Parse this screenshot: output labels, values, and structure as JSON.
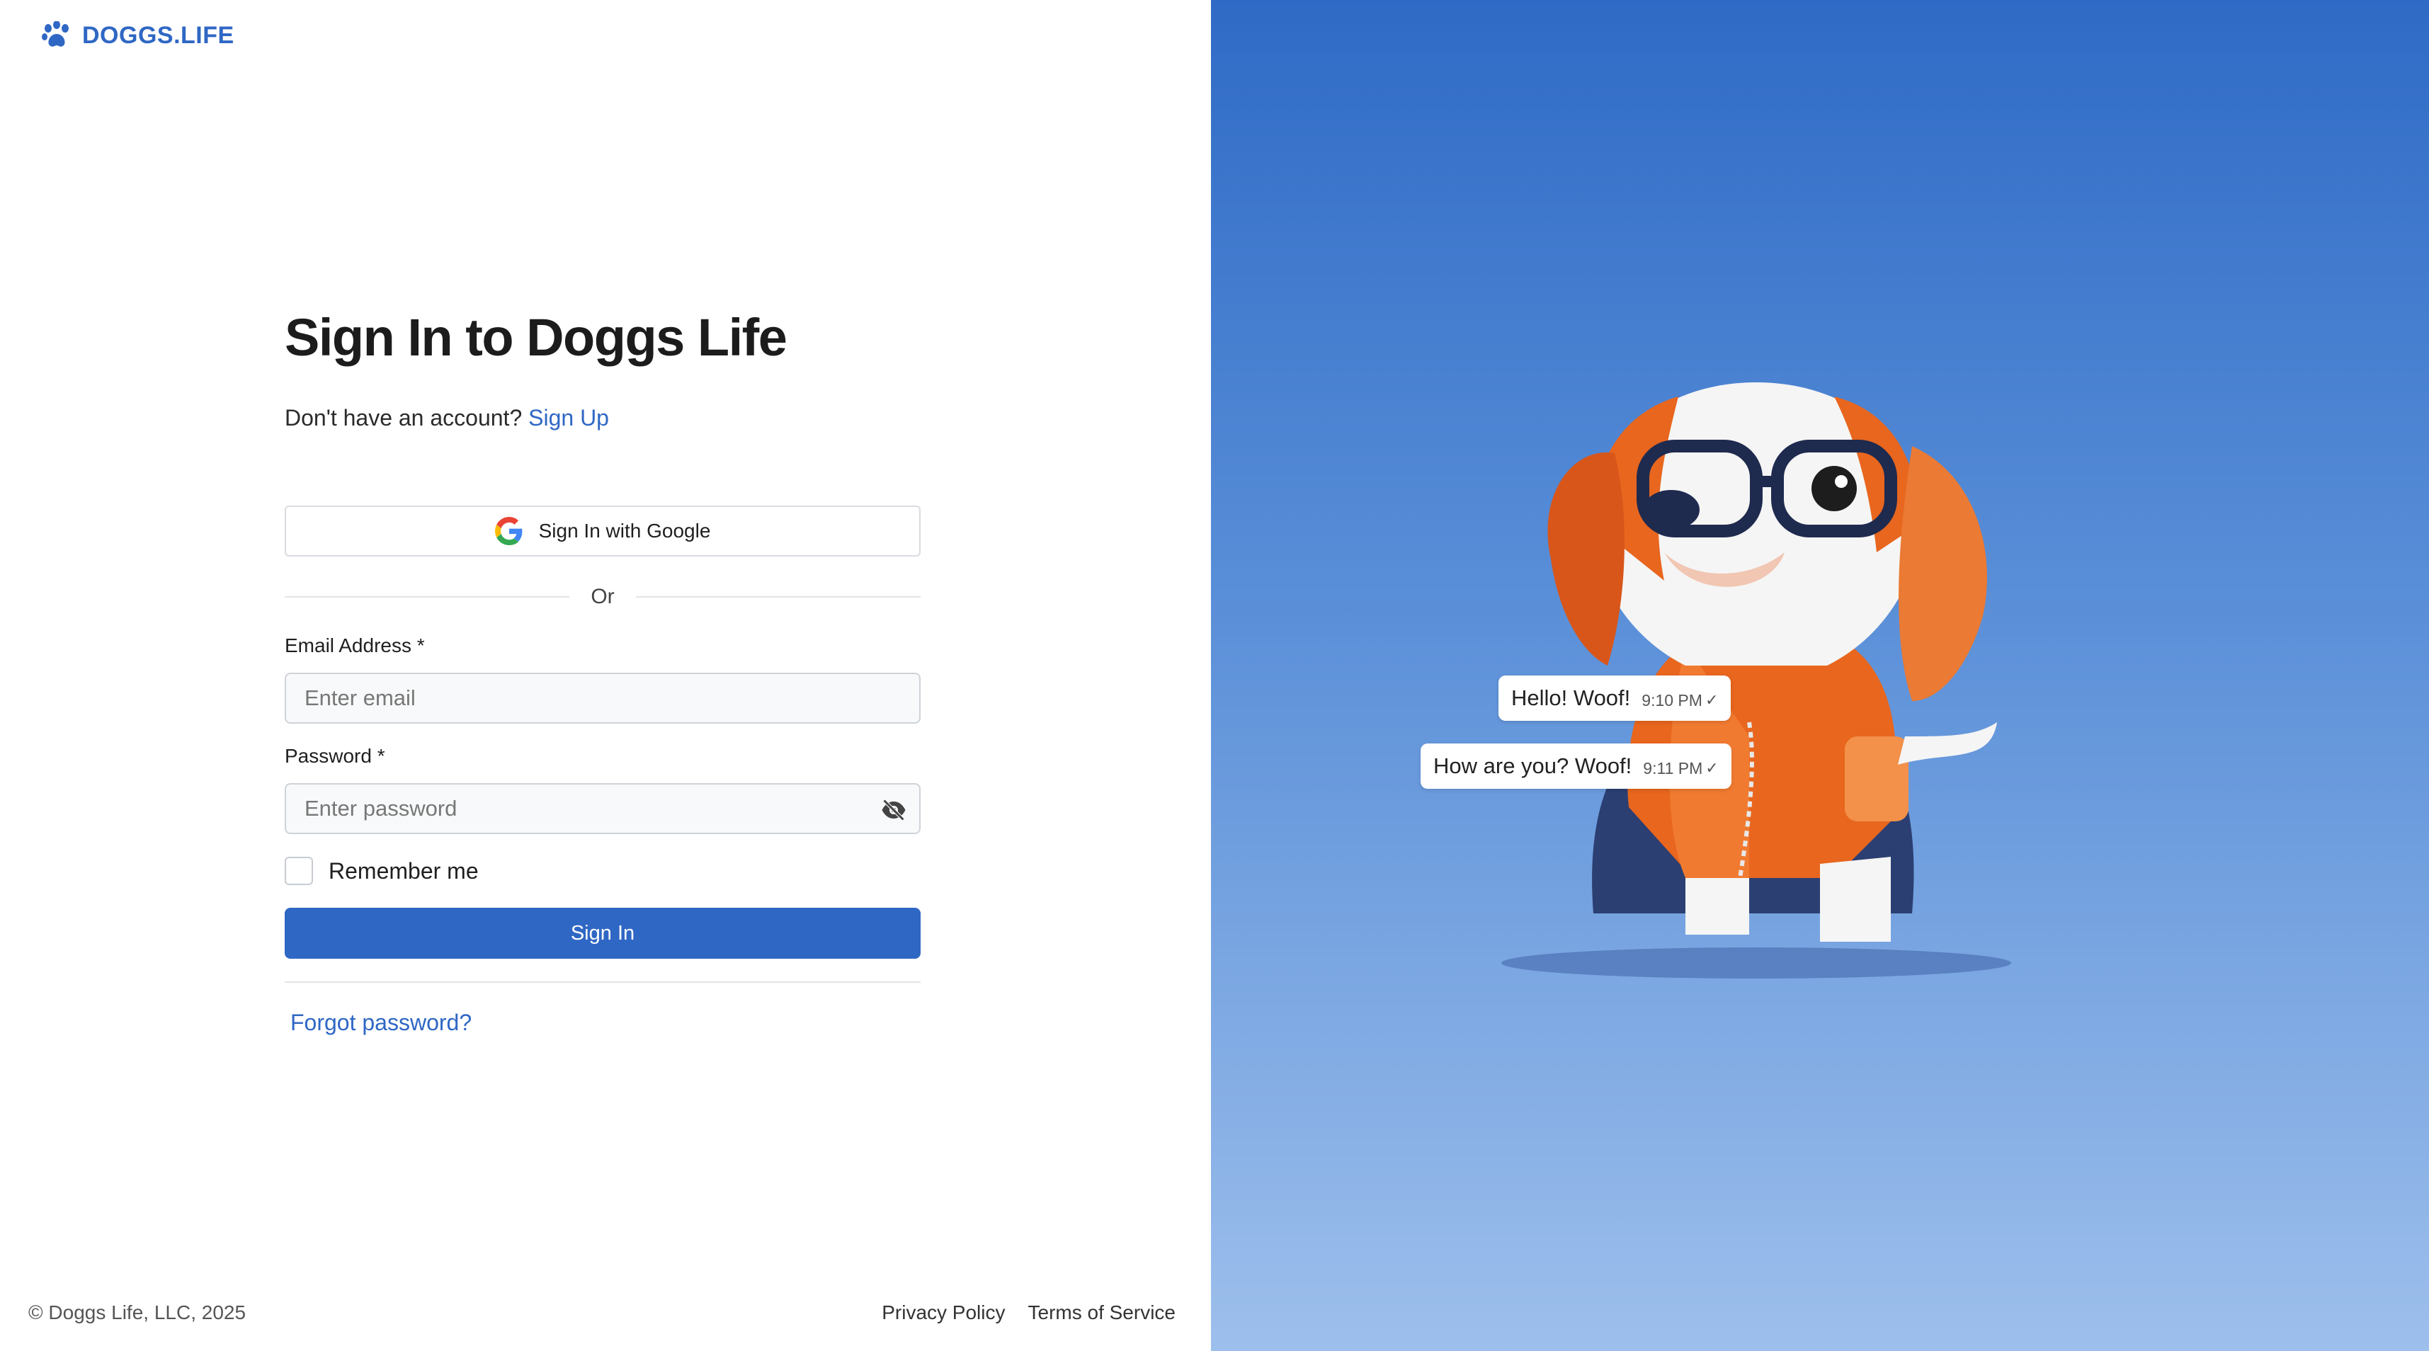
{
  "brand": {
    "name": "DOGGS.LIFE",
    "icon": "paw-icon",
    "color": "#2f67c4"
  },
  "signin": {
    "title": "Sign In to Doggs Life",
    "no_account": "Don't have an account?",
    "signup_link": "Sign Up",
    "google_button": "Sign In with Google",
    "divider": "Or",
    "email": {
      "label": "Email Address *",
      "placeholder": "Enter email",
      "value": ""
    },
    "password": {
      "label": "Password *",
      "placeholder": "Enter password",
      "value": "",
      "toggle_icon": "eye-off-icon"
    },
    "remember_label": "Remember me",
    "remember_checked": false,
    "submit": "Sign In",
    "forgot": "Forgot password?"
  },
  "footer": {
    "copyright": "© Doggs Life, LLC, 2025",
    "privacy": "Privacy Policy",
    "terms": "Terms of Service"
  },
  "hero": {
    "bubbles": [
      {
        "message": "Hello! Woof!",
        "time": "9:10 PM"
      },
      {
        "message": "How are you? Woof!",
        "time": "9:11 PM"
      }
    ],
    "illustration": "dog-illustration"
  },
  "colors": {
    "accent": "#2f67c4",
    "panel_top": "#2f6bc6",
    "panel_bottom": "#9dbfec"
  }
}
